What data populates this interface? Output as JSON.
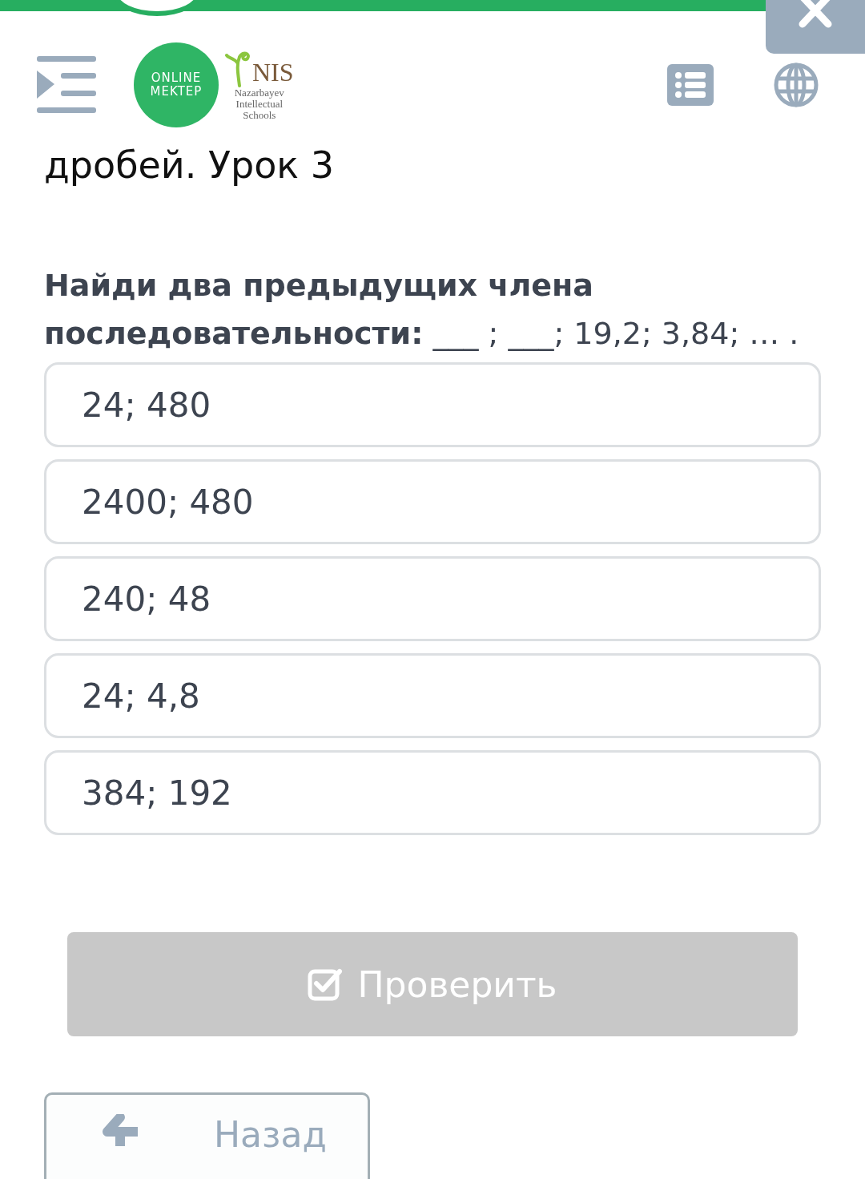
{
  "header": {
    "logo_text": "ONLINE MEKTEP",
    "partner_name": "NIS",
    "partner_subtitle": "Nazarbayev Intellectual Schools"
  },
  "lesson_title": "дробей. Урок 3",
  "question": "**Найди два предыдущих члена последовательности:** ___ ; ___; 19,2; 3,84; … .",
  "options": [
    {
      "label": "24; 480"
    },
    {
      "label": "2400; 480"
    },
    {
      "label": "240; 48"
    },
    {
      "label": "24; 4,8"
    },
    {
      "label": "384; 192"
    }
  ],
  "check_button": {
    "label": "Проверить",
    "disabled": true
  },
  "back_button": {
    "label": "Назад"
  }
}
